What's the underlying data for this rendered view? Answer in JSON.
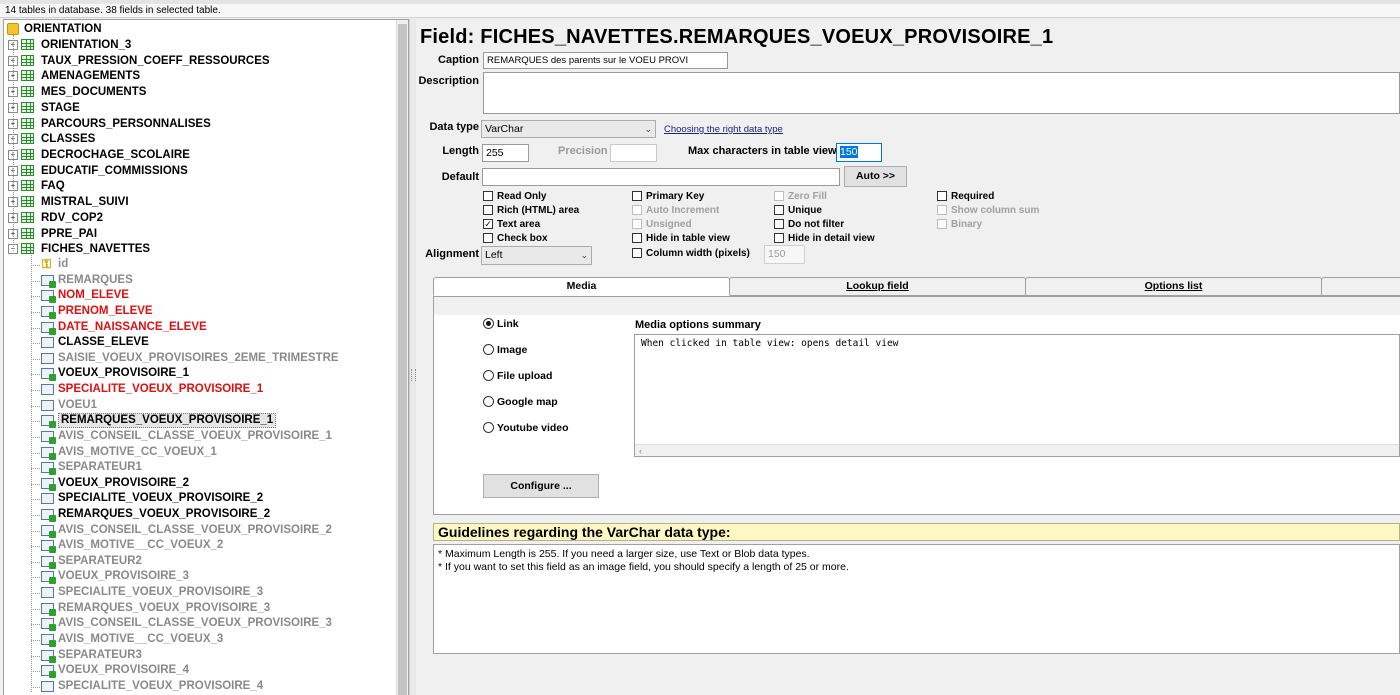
{
  "status": "14 tables in database. 38 fields in selected table.",
  "tree": {
    "root": "ORIENTATION",
    "tables": [
      "ORIENTATION_3",
      "TAUX_PRESSION_COEFF_RESSOURCES",
      "AMENAGEMENTS",
      "MES_DOCUMENTS",
      "STAGE",
      "PARCOURS_PERSONNALISES",
      "CLASSES",
      "DECROCHAGE_SCOLAIRE",
      "EDUCATIF_COMMISSIONS",
      "FAQ",
      "MISTRAL_SUIVI",
      "RDV_COP2",
      "PPRE_PAI",
      "FICHES_NAVETTES"
    ],
    "fields": [
      {
        "name": "id",
        "color": "gray",
        "icon": "key-icon"
      },
      {
        "name": "REMARQUES",
        "color": "gray",
        "icon": "field-icon"
      },
      {
        "name": "NOM_ELEVE",
        "color": "red",
        "icon": "field-icon"
      },
      {
        "name": "PRENOM_ELEVE",
        "color": "red",
        "icon": "field-icon"
      },
      {
        "name": "DATE_NAISSANCE_ELEVE",
        "color": "red",
        "icon": "field-icon"
      },
      {
        "name": "CLASSE_ELEVE",
        "color": "black",
        "icon": "field-plain-icon"
      },
      {
        "name": "SAISIE_VOEUX_PROVISOIRES_2EME_TRIMESTRE",
        "color": "gray",
        "icon": "field-plain-icon"
      },
      {
        "name": "VOEUX_PROVISOIRE_1",
        "color": "black",
        "icon": "field-icon"
      },
      {
        "name": "SPECIALITE_VOEUX_PROVISOIRE_1",
        "color": "red",
        "icon": "field-plain-icon"
      },
      {
        "name": "VOEU1",
        "color": "gray",
        "icon": "field-plain-icon"
      },
      {
        "name": "REMARQUES_VOEUX_PROVISOIRE_1",
        "color": "black",
        "icon": "field-icon",
        "selected": true
      },
      {
        "name": "AVIS_CONSEIL_CLASSE_VOEUX_PROVISOIRE_1",
        "color": "gray",
        "icon": "field-icon"
      },
      {
        "name": "AVIS_MOTIVE_CC_VOEUX_1",
        "color": "gray",
        "icon": "field-icon"
      },
      {
        "name": "SEPARATEUR1",
        "color": "gray",
        "icon": "field-icon"
      },
      {
        "name": "VOEUX_PROVISOIRE_2",
        "color": "black",
        "icon": "field-icon"
      },
      {
        "name": "SPECIALITE_VOEUX_PROVISOIRE_2",
        "color": "black",
        "icon": "field-plain-icon"
      },
      {
        "name": "REMARQUES_VOEUX_PROVISOIRE_2",
        "color": "black",
        "icon": "field-icon"
      },
      {
        "name": "AVIS_CONSEIL_CLASSE_VOEUX_PROVISOIRE_2",
        "color": "gray",
        "icon": "field-icon"
      },
      {
        "name": "AVIS_MOTIVE__CC_VOEUX_2",
        "color": "gray",
        "icon": "field-icon"
      },
      {
        "name": "SEPARATEUR2",
        "color": "gray",
        "icon": "field-icon"
      },
      {
        "name": "VOEUX_PROVISOIRE_3",
        "color": "gray",
        "icon": "field-icon"
      },
      {
        "name": "SPECIALITE_VOEUX_PROVISOIRE_3",
        "color": "gray",
        "icon": "field-plain-icon"
      },
      {
        "name": "REMARQUES_VOEUX_PROVISOIRE_3",
        "color": "gray",
        "icon": "field-icon"
      },
      {
        "name": "AVIS_CONSEIL_CLASSE_VOEUX_PROVISOIRE_3",
        "color": "gray",
        "icon": "field-icon"
      },
      {
        "name": "AVIS_MOTIVE__CC_VOEUX_3",
        "color": "gray",
        "icon": "field-icon"
      },
      {
        "name": "SEPARATEUR3",
        "color": "gray",
        "icon": "field-icon"
      },
      {
        "name": "VOEUX_PROVISOIRE_4",
        "color": "gray",
        "icon": "field-icon"
      },
      {
        "name": "SPECIALITE_VOEUX_PROVISOIRE_4",
        "color": "gray",
        "icon": "field-plain-icon"
      }
    ]
  },
  "field": {
    "title": "Field: FICHES_NAVETTES.REMARQUES_VOEUX_PROVISOIRE_1",
    "caption_label": "Caption",
    "caption_value": "REMARQUES des parents sur le VOEU PROVI",
    "description_label": "Description",
    "description_value": "",
    "datatype_label": "Data type",
    "datatype_value": "VarChar",
    "datatype_link": "Choosing the right data type",
    "length_label": "Length",
    "length_value": "255",
    "precision_label": "Precision",
    "precision_value": "",
    "maxchars_label": "Max characters in table view",
    "maxchars_value": "150",
    "default_label": "Default",
    "default_value": "",
    "auto_button": "Auto >>",
    "alignment_label": "Alignment",
    "alignment_value": "Left",
    "colwidth_value": "150"
  },
  "checkboxes": [
    {
      "label": "Read Only",
      "checked": false,
      "disabled": false
    },
    {
      "label": "Rich (HTML) area",
      "checked": false,
      "disabled": false
    },
    {
      "label": "Text area",
      "checked": true,
      "disabled": false
    },
    {
      "label": "Check box",
      "checked": false,
      "disabled": false
    },
    {
      "label": "Primary Key",
      "checked": false,
      "disabled": false
    },
    {
      "label": "Auto Increment",
      "checked": false,
      "disabled": true
    },
    {
      "label": "Unsigned",
      "checked": false,
      "disabled": true
    },
    {
      "label": "Hide in table view",
      "checked": false,
      "disabled": false
    },
    {
      "label": "Column width (pixels)",
      "checked": false,
      "disabled": false
    },
    {
      "label": "Zero Fill",
      "checked": false,
      "disabled": true
    },
    {
      "label": "Unique",
      "checked": false,
      "disabled": false
    },
    {
      "label": "Do not filter",
      "checked": false,
      "disabled": false
    },
    {
      "label": "Hide in detail view",
      "checked": false,
      "disabled": false
    },
    {
      "label": "Required",
      "checked": false,
      "disabled": false
    },
    {
      "label": "Show column sum",
      "checked": false,
      "disabled": true
    },
    {
      "label": "Binary",
      "checked": false,
      "disabled": true
    }
  ],
  "tabs": [
    "Media",
    "Lookup field",
    "Options list"
  ],
  "media": {
    "radios": [
      {
        "label": "Link",
        "selected": true
      },
      {
        "label": "Image",
        "selected": false
      },
      {
        "label": "File upload",
        "selected": false
      },
      {
        "label": "Google map",
        "selected": false
      },
      {
        "label": "Youtube video",
        "selected": false
      }
    ],
    "summary_label": "Media options summary",
    "summary_text": "When clicked in table view: opens detail view",
    "configure_button": "Configure ..."
  },
  "guidelines": {
    "title": "Guidelines regarding the VarChar data type:",
    "lines": [
      "* Maximum Length is 255. If you need a larger size, use Text or Blob data types.",
      "* If you want to set this field as an image field, you should specify a length of 25 or more."
    ]
  },
  "colors": {
    "red": "#dd1111",
    "gray": "#8a8a8a",
    "black": "#000000",
    "guide_bg": "#fdf7c4",
    "selection": "#0078d7"
  }
}
